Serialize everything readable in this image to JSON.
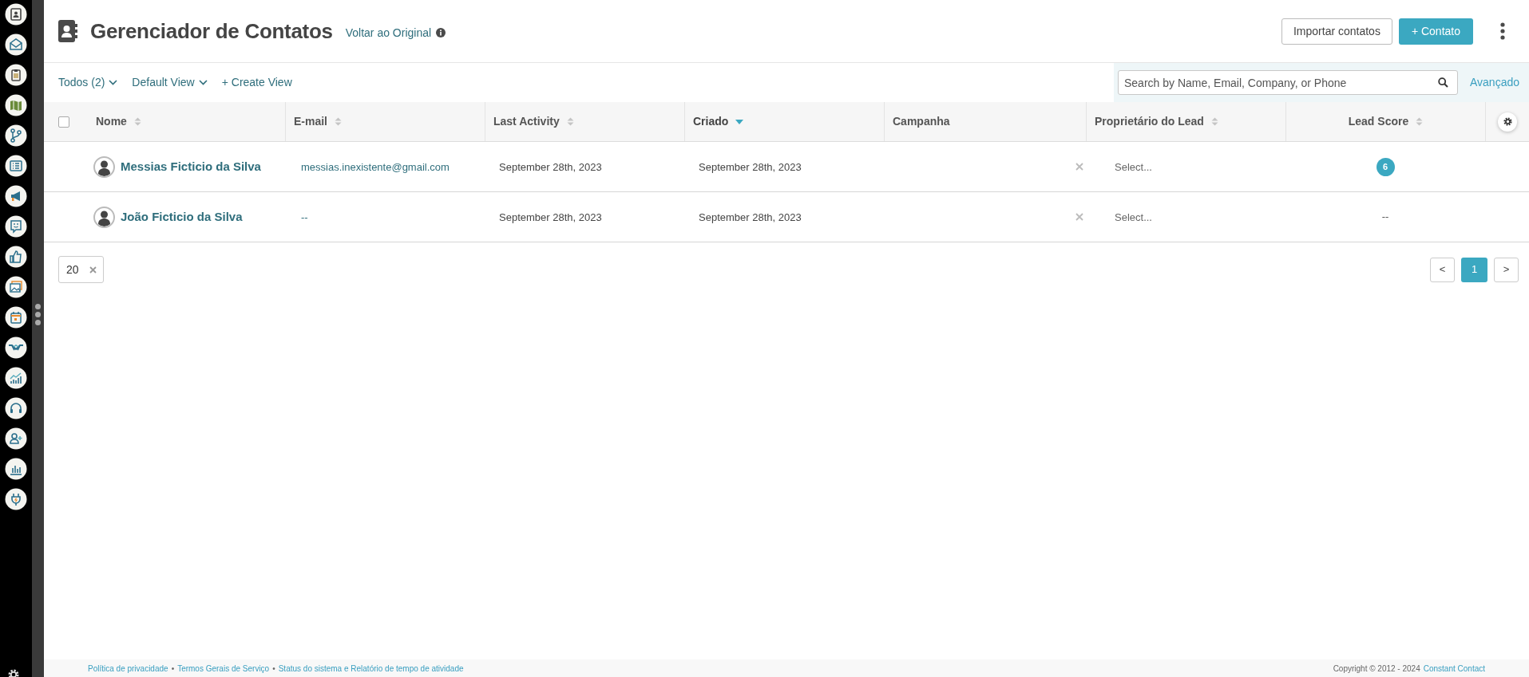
{
  "header": {
    "title": "Gerenciador de Contatos",
    "back_link": "Voltar ao Original",
    "buttons": [
      {
        "label": "Importar contatos",
        "kind": "outline"
      },
      {
        "label": "+ Contato",
        "kind": "primary"
      }
    ]
  },
  "toolbar": {
    "filters": [
      {
        "label": "Todos",
        "count": "(2)",
        "kind": "dropdown"
      },
      {
        "label": "Default View",
        "kind": "dropdown"
      },
      {
        "label": "+ Create View",
        "kind": "link"
      }
    ],
    "search": {
      "placeholder": "Search by Name, Email, Company, or Phone"
    },
    "advanced_link": "Avançado"
  },
  "table": {
    "select_all": {
      "checked": false
    },
    "columns": [
      {
        "label": "Nome",
        "sortable": true,
        "sorted": false
      },
      {
        "label": "E-mail",
        "sortable": true,
        "sorted": false
      },
      {
        "label": "Last Activity",
        "sortable": true,
        "sorted": false
      },
      {
        "label": "Criado",
        "sortable": true,
        "sorted": true
      },
      {
        "label": "Campanha",
        "sortable": false,
        "sorted": false
      },
      {
        "label": "Proprietário do Lead",
        "sortable": true,
        "sorted": false
      },
      {
        "label": "Lead Score",
        "sortable": true,
        "sorted": false
      }
    ],
    "rows": [
      {
        "name": "Messias Ficticio da Silva",
        "email": "messias.inexistente@gmail.com",
        "last_activity": "September 28th, 2023",
        "created": "September 28th, 2023",
        "owner_placeholder": "Select...",
        "lead_score": {
          "value": "6",
          "kind": "badge"
        }
      },
      {
        "name": "João Ficticio da Silva",
        "email": "--",
        "last_activity": "September 28th, 2023",
        "created": "September 28th, 2023",
        "owner_placeholder": "Select...",
        "lead_score": {
          "value": "--",
          "kind": "text"
        }
      }
    ]
  },
  "page_size": "20",
  "pagination": [
    {
      "label": "<",
      "selected": false
    },
    {
      "label": "1",
      "selected": true
    },
    {
      "label": ">",
      "selected": false
    }
  ],
  "footer": {
    "links": [
      "Política de privacidade",
      "Termos Gerais de Serviço",
      "Status do sistema e Relatório de tempo de atividade"
    ],
    "separator": "•",
    "copyright": "Copyright © 2012 - 2024",
    "company_link": "Constant Contact"
  }
}
